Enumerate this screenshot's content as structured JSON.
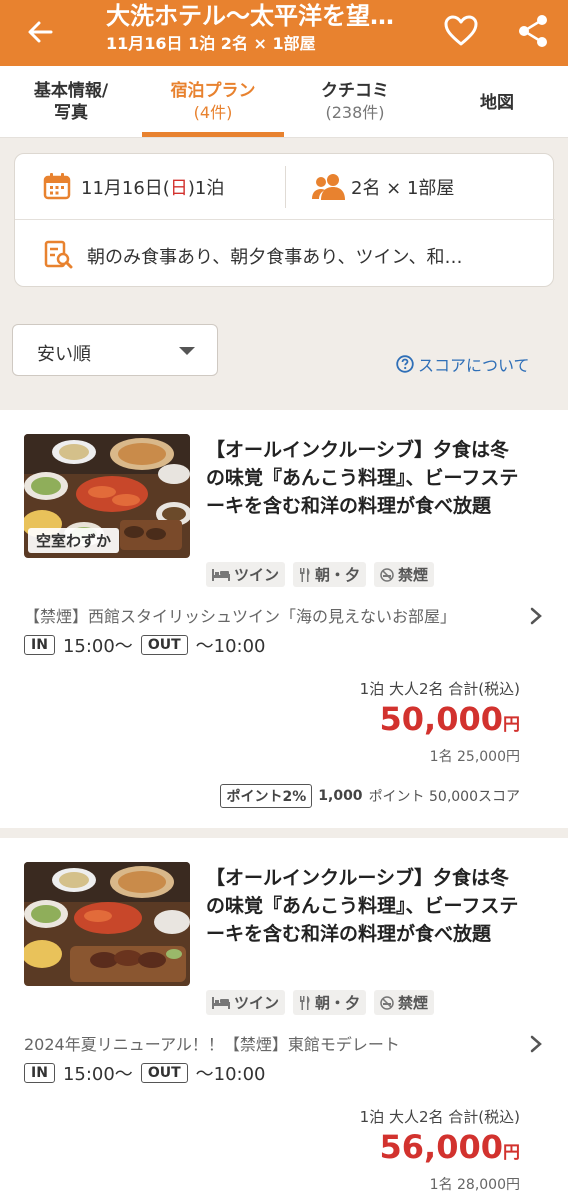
{
  "header": {
    "title": "大洗ホテル〜太平洋を望…",
    "subtitle": "11月16日 1泊 2名 × 1部屋",
    "back_icon": "arrow-left-icon",
    "favorite_icon": "heart-icon",
    "share_icon": "share-icon",
    "colors": {
      "accent": "#e8822f",
      "price": "#d2322e",
      "link": "#2f6fb7"
    }
  },
  "tabs": [
    {
      "label": "基本情報/",
      "label2": "写真",
      "count": ""
    },
    {
      "label": "宿泊プラン",
      "count": "(4件)"
    },
    {
      "label": "クチコミ",
      "count": "(238件)"
    },
    {
      "label": "地図",
      "count": ""
    }
  ],
  "search": {
    "date_prefix": "11月16日(",
    "date_day": "日",
    "date_suffix": ")1泊",
    "guests": "2名 × 1部屋",
    "conditions": "朝のみ食事あり、朝夕食事あり、ツイン、和…"
  },
  "sort": {
    "label": "安い順"
  },
  "score_link": "スコアについて",
  "plans": [
    {
      "badge": "空室わずか",
      "title": "【オールインクルーシブ】夕食は冬の味覚『あんこう料理』、ビーフステーキを含む和洋の料理が食べ放題",
      "tags": [
        "ツイン",
        "朝・夕",
        "禁煙"
      ],
      "room": "【禁煙】西館スタイリッシュツイン「海の見えないお部屋」",
      "in_label": "IN",
      "in_time": "15:00〜",
      "out_label": "OUT",
      "out_time": "〜10:00",
      "price_caption": "1泊 大人2名 合計(税込)",
      "price": "50,000",
      "yen": "円",
      "per_person": "1名 25,000円",
      "points_badge": "ポイント2%",
      "points": "1,000",
      "points_suffix": "ポイント 50,000スコア"
    },
    {
      "badge": "",
      "title": "【オールインクルーシブ】夕食は冬の味覚『あんこう料理』、ビーフステーキを含む和洋の料理が食べ放題",
      "tags": [
        "ツイン",
        "朝・夕",
        "禁煙"
      ],
      "room": "2024年夏リニューアル！！【禁煙】東館モデレート",
      "in_label": "IN",
      "in_time": "15:00〜",
      "out_label": "OUT",
      "out_time": "〜10:00",
      "price_caption": "1泊 大人2名 合計(税込)",
      "price": "56,000",
      "yen": "円",
      "per_person": "1名 28,000円"
    }
  ]
}
